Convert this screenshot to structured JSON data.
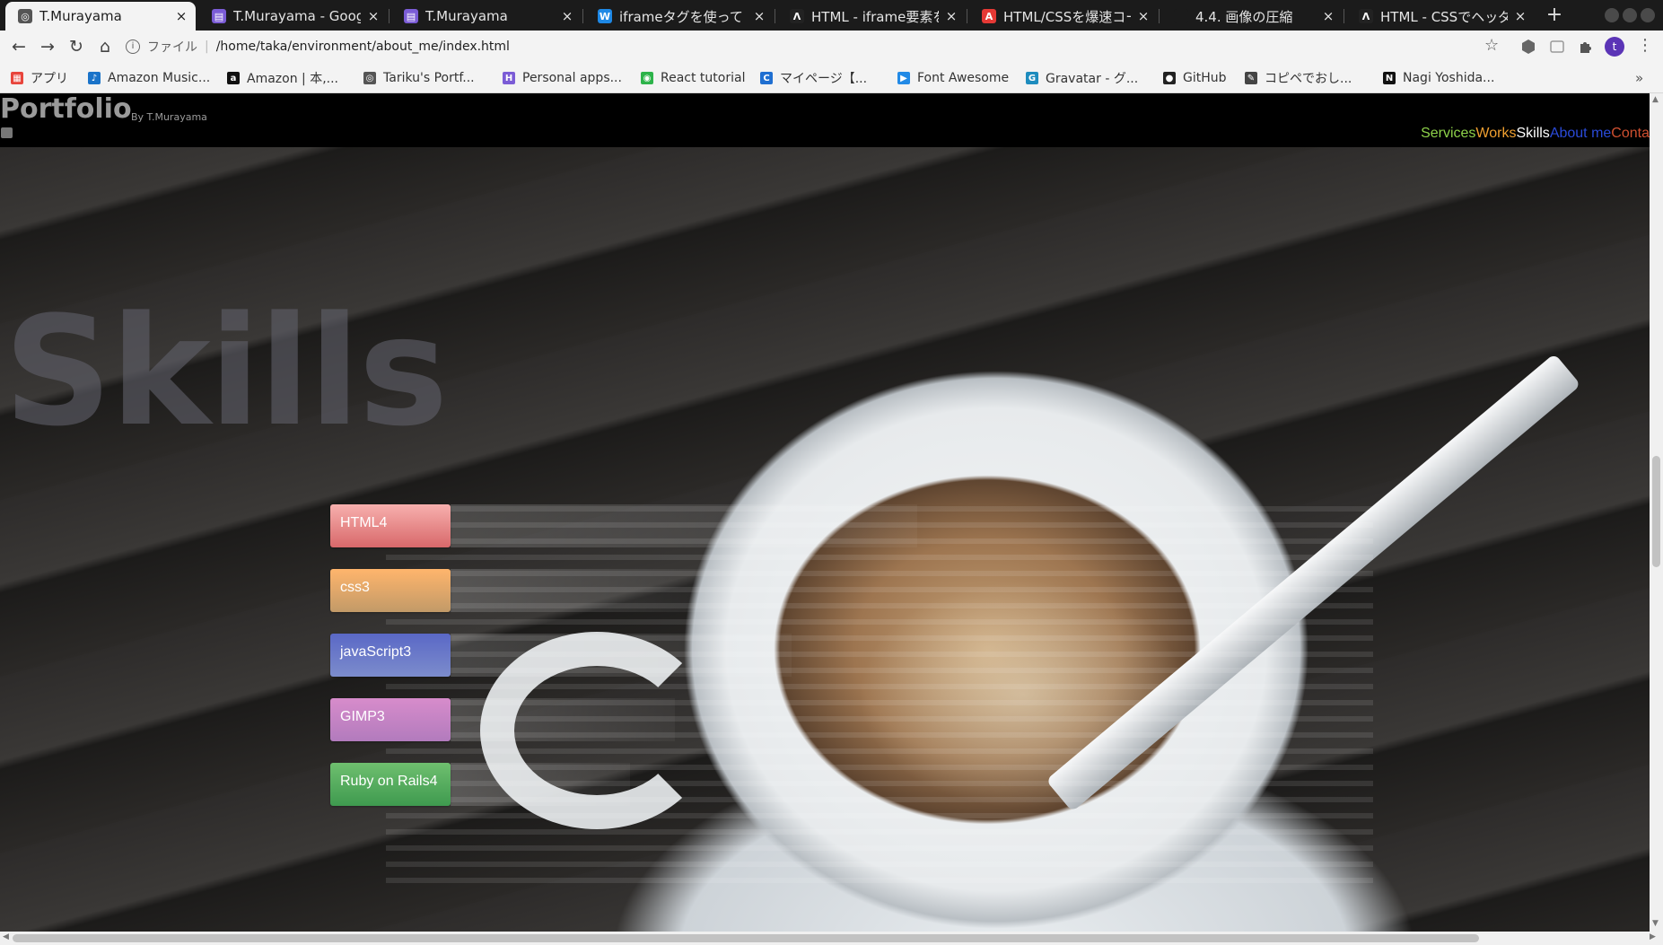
{
  "browser": {
    "tabs": [
      {
        "title": "T.Murayama",
        "favicon_color": "#555555",
        "favicon_glyph": "◎",
        "active": true
      },
      {
        "title": "T.Murayama - Google",
        "favicon_color": "#7b5cd6",
        "favicon_glyph": "▤",
        "active": false
      },
      {
        "title": "T.Murayama",
        "favicon_color": "#7b5cd6",
        "favicon_glyph": "▤",
        "active": false
      },
      {
        "title": "iframeタグを使って",
        "favicon_color": "#1e88e5",
        "favicon_glyph": "W",
        "active": false
      },
      {
        "title": "HTML - iframe要素を",
        "favicon_color": "#222222",
        "favicon_glyph": "Λ",
        "active": false
      },
      {
        "title": "HTML/CSSを爆速コー",
        "favicon_color": "#e53935",
        "favicon_glyph": "A",
        "active": false
      },
      {
        "title": "4.4. 画像の圧縮",
        "favicon_color": "#1b1b1b",
        "favicon_glyph": "",
        "active": false
      },
      {
        "title": "HTML - CSSでヘッダー",
        "favicon_color": "#222222",
        "favicon_glyph": "Λ",
        "active": false
      }
    ],
    "tab_close_glyph": "×",
    "new_tab_glyph": "+",
    "nav": {
      "back": "←",
      "forward": "→",
      "reload": "↻",
      "home": "⌂"
    },
    "address": {
      "scheme_label": "ファイル",
      "url": "/home/taka/environment/about_me/index.html"
    },
    "profile_initial": "t",
    "bookmarks": [
      {
        "label": "アプリ",
        "icon": "apps-grid-icon",
        "color": "#e8453c",
        "glyph": "▦"
      },
      {
        "label": "Amazon Music...",
        "icon": "amazon-music-icon",
        "color": "#1a73c9",
        "glyph": "♪"
      },
      {
        "label": "Amazon | 本,...",
        "icon": "amazon-icon",
        "color": "#111111",
        "glyph": "a"
      },
      {
        "label": "Tariku's Portf...",
        "icon": "globe-icon",
        "color": "#555555",
        "glyph": "◎"
      },
      {
        "label": "Personal apps...",
        "icon": "heroku-icon",
        "color": "#7b5cd6",
        "glyph": "H"
      },
      {
        "label": "React tutorial",
        "icon": "react-icon",
        "color": "#2db34a",
        "glyph": "◉"
      },
      {
        "label": "マイページ【...",
        "icon": "crowdworks-icon",
        "color": "#1f6fd1",
        "glyph": "C"
      },
      {
        "label": "Font Awesome",
        "icon": "font-awesome-icon",
        "color": "#228ae6",
        "glyph": "▶"
      },
      {
        "label": "Gravatar - グ...",
        "icon": "gravatar-icon",
        "color": "#1e8cbe",
        "glyph": "G"
      },
      {
        "label": "GitHub",
        "icon": "github-icon",
        "color": "#222222",
        "glyph": "●"
      },
      {
        "label": "コピペでおし...",
        "icon": "copipe-icon",
        "color": "#444444",
        "glyph": "✎"
      },
      {
        "label": "Nagi Yoshida...",
        "icon": "notion-icon",
        "color": "#111111",
        "glyph": "N"
      }
    ],
    "bookmarks_overflow": "»"
  },
  "site": {
    "logo": "Portfolio",
    "byline": "By T.Murayama",
    "nav": [
      {
        "label": "Services",
        "color": "#8ed24a"
      },
      {
        "label": "Works",
        "color": "#f0a030"
      },
      {
        "label": "Skills",
        "color": "#ffffff"
      },
      {
        "label": "About me",
        "color": "#2a4ad8"
      },
      {
        "label": "Conta",
        "color": "#d05030"
      }
    ],
    "section_heading": "Skills",
    "skills": [
      {
        "label": "HTML4",
        "color_top": "#f7b0ae",
        "color_bottom": "#d8686a",
        "bar_width": 520
      },
      {
        "label": "css3",
        "color_top": "#ffb56c",
        "color_bottom": "#c29a68",
        "bar_width": 300
      },
      {
        "label": "javaScript3",
        "color_top": "#5a68c6",
        "color_bottom": "#7c8ccc",
        "bar_width": 380
      },
      {
        "label": "GIMP3",
        "color_top": "#d78ccb",
        "color_bottom": "#b27bbd",
        "bar_width": 250
      },
      {
        "label": "Ruby on Rails4",
        "color_top": "#6fbf6f",
        "color_bottom": "#3f9a4f",
        "bar_width": 200
      }
    ]
  }
}
